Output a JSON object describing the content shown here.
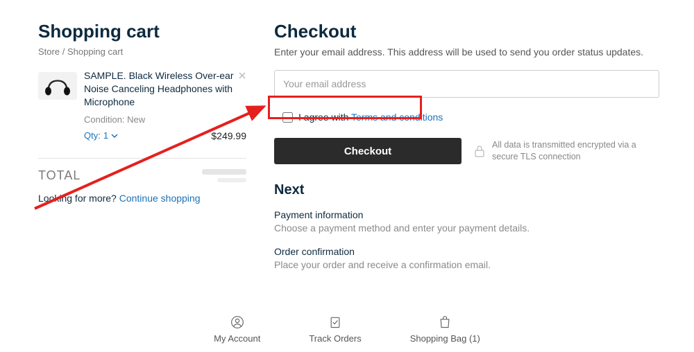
{
  "cart": {
    "heading": "Shopping cart",
    "breadcrumb_store": "Store",
    "breadcrumb_sep": "/",
    "breadcrumb_current": "Shopping cart",
    "item": {
      "title": "SAMPLE. Black Wireless Over-ear Noise Canceling Headphones with Microphone",
      "condition": "Condition: New",
      "qty_label": "Qty:",
      "qty_value": "1",
      "price": "$249.99"
    },
    "total_label": "TOTAL",
    "continue_prefix": "Looking for more? ",
    "continue_link": "Continue shopping"
  },
  "checkout": {
    "heading": "Checkout",
    "subtitle": "Enter your email address. This address will be used to send you order status updates.",
    "email_placeholder": "Your email address",
    "agree_prefix": "I agree with ",
    "agree_link": "Terms and conditions",
    "button": "Checkout",
    "secure_note": "All data is transmitted encrypted via a secure TLS connection",
    "next_heading": "Next",
    "steps": [
      {
        "title": "Payment information",
        "desc": "Choose a payment method and enter your payment details."
      },
      {
        "title": "Order confirmation",
        "desc": "Place your order and receive a confirmation email."
      }
    ]
  },
  "footer": {
    "account": "My Account",
    "track": "Track Orders",
    "bag": "Shopping Bag (1)"
  }
}
